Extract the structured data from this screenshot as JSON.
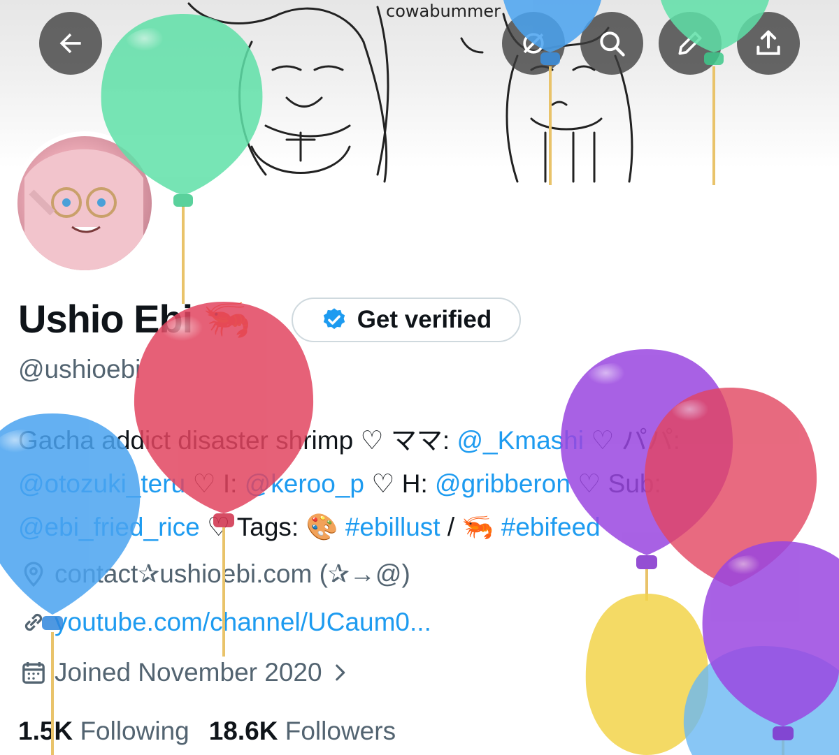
{
  "banner": {
    "caption": "cowabummer"
  },
  "nav": {
    "back_icon": "arrow-left-icon",
    "grok_icon": "grok-icon",
    "search_icon": "search-icon",
    "edit_icon": "pencil-icon",
    "share_icon": "share-upload-icon"
  },
  "profile": {
    "display_name": "Ushio Ebi",
    "name_emoji": "🦐",
    "verify_label": "Get verified",
    "handle": "@ushioebi",
    "bio": {
      "line1_a": "Gacha addict disaster shrimp ♡ ママ: ",
      "line1_mention": "@_Kmashi",
      "line1_b": " ♡ パパ:",
      "line2_mention1": "@otozuki_teru",
      "line2_a": " ♡ I: ",
      "line2_mention2": "@keroo_p",
      "line2_b": " ♡ H: ",
      "line2_mention3": "@gribberon",
      "line2_c": " ♡ Sub:",
      "line3_mention": "@ebi_fried_rice",
      "line3_a": " ♡ Tags: 🎨 ",
      "line3_tag1": "#ebillust",
      "line3_b": " / 🦐 ",
      "line3_tag2": "#ebifeed"
    },
    "location": "contact✰ushioebi.com (✰→@)",
    "website": "youtube.com/channel/UCaum0...",
    "joined": "Joined November 2020",
    "following_count": "1.5K",
    "following_label": "Following",
    "followers_count": "18.6K",
    "followers_label": "Followers"
  },
  "colors": {
    "link": "#1d9bf0",
    "secondary_text": "#536471",
    "verified_badge": "#1d9bf0"
  }
}
